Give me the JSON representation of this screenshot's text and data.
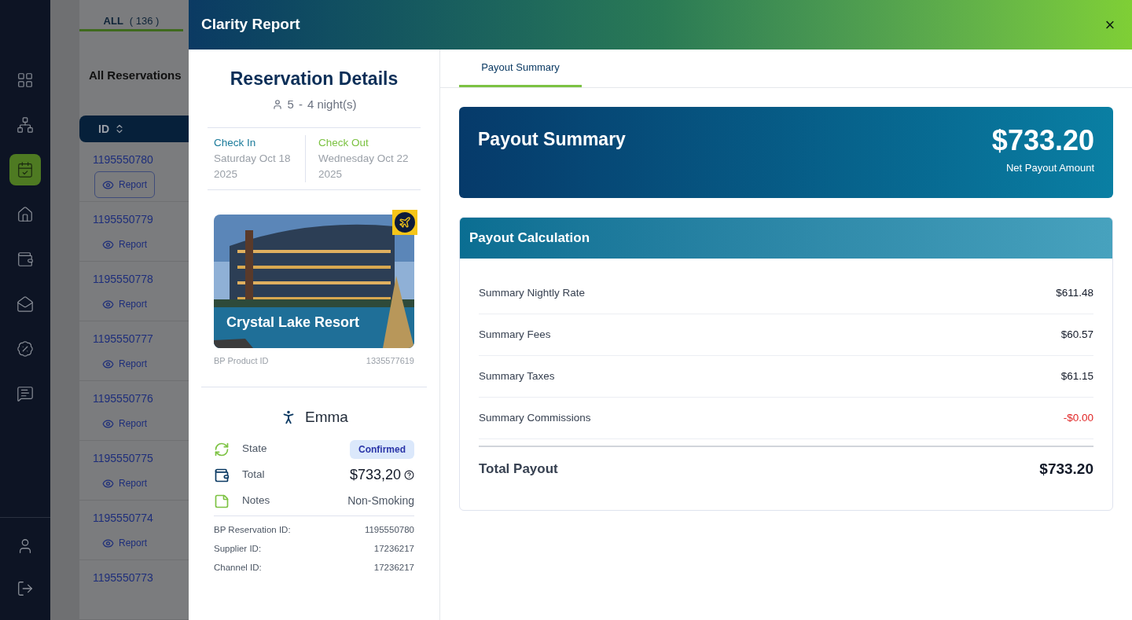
{
  "sidebar": {
    "nav_items": [
      {
        "kind": "grid",
        "selected": false
      },
      {
        "kind": "network",
        "selected": false
      },
      {
        "kind": "calendar",
        "selected": true
      },
      {
        "kind": "home",
        "selected": false
      },
      {
        "kind": "wallet",
        "selected": false
      },
      {
        "kind": "mail",
        "selected": false
      },
      {
        "kind": "percent",
        "selected": false
      },
      {
        "kind": "reviews",
        "selected": false
      }
    ],
    "bottom_items": [
      {
        "kind": "user"
      },
      {
        "kind": "logout"
      }
    ]
  },
  "background": {
    "tab": {
      "label": "ALL",
      "count": "( 136 )",
      "selected": true
    },
    "heading": "All Reservations",
    "table": {
      "columns": [
        "ID"
      ],
      "rows": [
        {
          "id": "1195550780",
          "action": "Report",
          "highlighted": true
        },
        {
          "id": "1195550779",
          "action": "Report",
          "highlighted": false
        },
        {
          "id": "1195550778",
          "action": "Report",
          "highlighted": false
        },
        {
          "id": "1195550777",
          "action": "Report",
          "highlighted": false
        },
        {
          "id": "1195550776",
          "action": "Report",
          "highlighted": false
        },
        {
          "id": "1195550775",
          "action": "Report",
          "highlighted": false
        },
        {
          "id": "1195550774",
          "action": "Report",
          "highlighted": false
        },
        {
          "id": "1195550773"
        }
      ]
    }
  },
  "modal": {
    "title": "Clarity Report",
    "close": "×",
    "reservation": {
      "title": "Reservation Details",
      "guests": "5",
      "separator": "-",
      "nights": "4 night(s)",
      "check_in": {
        "label": "Check In",
        "date": "Saturday Oct 18 2025"
      },
      "check_out": {
        "label": "Check Out",
        "date": "Wednesday Oct 22 2025"
      },
      "property": {
        "name": "Crystal Lake Resort",
        "product_id_label": "BP Product ID",
        "product_id": "1335577619"
      },
      "guest_name": "Emma",
      "details": [
        {
          "kind": "state",
          "label": "State",
          "value": "Confirmed"
        },
        {
          "kind": "total",
          "label": "Total",
          "value": "$733,20"
        },
        {
          "kind": "notes",
          "label": "Notes",
          "value": "Non-Smoking"
        }
      ],
      "ids": [
        {
          "label": "BP Reservation ID:",
          "value": "1195550780"
        },
        {
          "label": "Supplier ID:",
          "value": "17236217"
        },
        {
          "label": "Channel ID:",
          "value": "17236217"
        }
      ]
    },
    "tabs": [
      {
        "label": "Payout Summary",
        "selected": true
      }
    ],
    "summary": {
      "title": "Payout Summary",
      "amount": "$733.20",
      "caption": "Net Payout Amount"
    },
    "calculation": {
      "title": "Payout Calculation",
      "rows": [
        {
          "label": "Summary Nightly Rate",
          "value": "$611.48",
          "negative": false
        },
        {
          "label": "Summary Fees",
          "value": "$60.57",
          "negative": false
        },
        {
          "label": "Summary Taxes",
          "value": "$61.15",
          "negative": false
        },
        {
          "label": "Summary Commissions",
          "value": "-$0.00",
          "negative": true
        }
      ],
      "total": {
        "label": "Total Payout",
        "value": "$733.20"
      }
    }
  }
}
